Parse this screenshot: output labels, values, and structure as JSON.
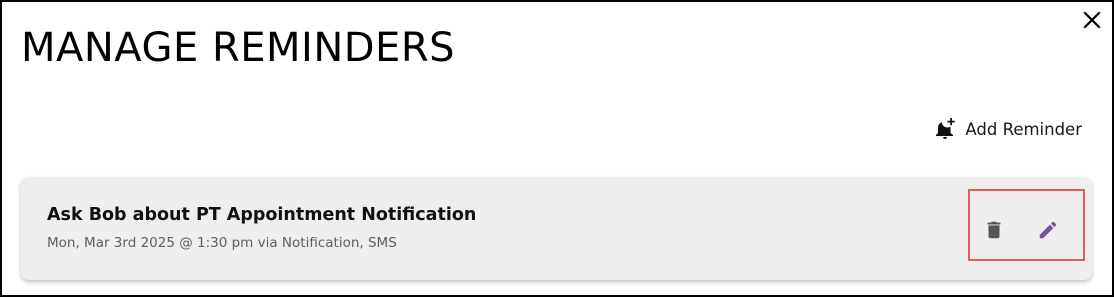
{
  "dialog": {
    "title": "MANAGE REMINDERS",
    "close_icon": "close-icon"
  },
  "toolbar": {
    "add_reminder_label": "Add Reminder",
    "add_reminder_icon": "bell-plus-icon"
  },
  "reminders": [
    {
      "title": "Ask Bob about PT Appointment Notification",
      "subtitle": "Mon, Mar 3rd 2025 @ 1:30 pm via Notification, SMS",
      "delete_icon": "trash-icon",
      "edit_icon": "pencil-icon"
    }
  ],
  "colors": {
    "card_background": "#eeeeee",
    "highlight_border": "#e35d5d",
    "edit_icon": "#7a5597",
    "delete_icon": "#555555",
    "text_primary": "#111111",
    "text_secondary": "#5f5f5f"
  }
}
